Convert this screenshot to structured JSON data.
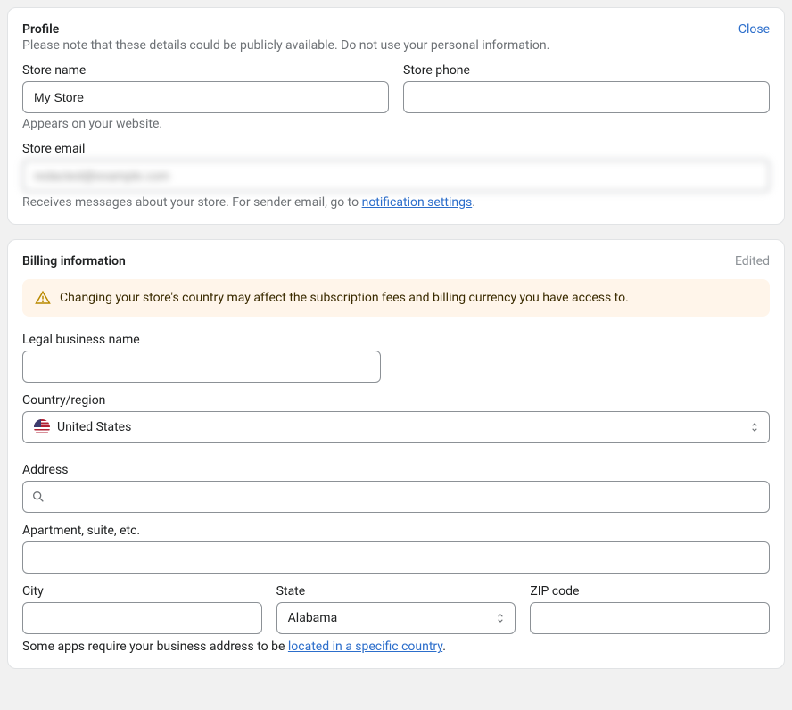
{
  "profile": {
    "title": "Profile",
    "subtitle": "Please note that these details could be publicly available. Do not use your personal information.",
    "close": "Close",
    "storeName": {
      "label": "Store name",
      "value": "My Store",
      "help": "Appears on your website."
    },
    "storePhone": {
      "label": "Store phone",
      "value": ""
    },
    "storeEmail": {
      "label": "Store email",
      "value": "redacted@example.com",
      "helpPrefix": "Receives messages about your store. For sender email, go to ",
      "helpLink": "notification settings",
      "helpSuffix": "."
    }
  },
  "billing": {
    "title": "Billing information",
    "edited": "Edited",
    "alert": "Changing your store's country may affect the subscription fees and billing currency you have access to.",
    "legalName": {
      "label": "Legal business name",
      "value": ""
    },
    "country": {
      "label": "Country/region",
      "value": "United States"
    },
    "address": {
      "label": "Address",
      "value": ""
    },
    "apartment": {
      "label": "Apartment, suite, etc.",
      "value": ""
    },
    "city": {
      "label": "City",
      "value": ""
    },
    "state": {
      "label": "State",
      "value": "Alabama"
    },
    "zip": {
      "label": "ZIP code",
      "value": ""
    },
    "notePrefix": "Some apps require your business address to be ",
    "noteLink": "located in a specific country",
    "noteSuffix": "."
  }
}
